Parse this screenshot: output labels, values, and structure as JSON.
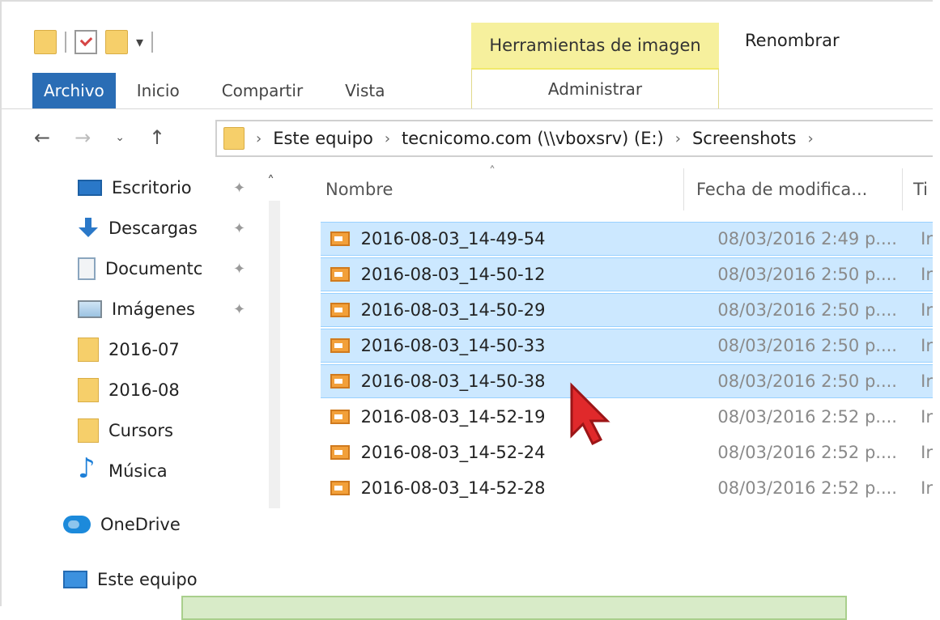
{
  "window": {
    "context_tab_group": "Herramientas de imagen",
    "context_tab": "Administrar",
    "rename_label": "Renombrar"
  },
  "ribbon": {
    "tabs": [
      {
        "label": "Archivo"
      },
      {
        "label": "Inicio"
      },
      {
        "label": "Compartir"
      },
      {
        "label": "Vista"
      }
    ]
  },
  "address": {
    "back": "←",
    "forward": "→",
    "recent": "⌄",
    "up": "↑",
    "crumbs": [
      "Este equipo",
      "tecnicomo.com (\\\\vboxsrv) (E:)",
      "Screenshots"
    ]
  },
  "navpane": {
    "quick_access": [
      {
        "label": "Escritorio",
        "icon": "desktop-icon",
        "pinned": true
      },
      {
        "label": "Descargas",
        "icon": "download-icon",
        "pinned": true
      },
      {
        "label": "Documentc",
        "icon": "document-icon",
        "pinned": true
      },
      {
        "label": "Imágenes",
        "icon": "pictures-icon",
        "pinned": true
      },
      {
        "label": "2016-07",
        "icon": "folder-icon",
        "pinned": false
      },
      {
        "label": "2016-08",
        "icon": "folder-icon",
        "pinned": false
      },
      {
        "label": "Cursors",
        "icon": "folder-icon",
        "pinned": false
      },
      {
        "label": "Música",
        "icon": "music-icon",
        "pinned": false
      }
    ],
    "onedrive": "OneDrive",
    "this_pc": "Este equipo"
  },
  "filelist": {
    "columns": {
      "name": "Nombre",
      "date": "Fecha de modifica...",
      "type": "Ti"
    },
    "rows": [
      {
        "name": "2016-08-03_14-49-54",
        "date": "08/03/2016 2:49 p....",
        "type": "Ir",
        "selected": true
      },
      {
        "name": "2016-08-03_14-50-12",
        "date": "08/03/2016 2:50 p....",
        "type": "Ir",
        "selected": true
      },
      {
        "name": "2016-08-03_14-50-29",
        "date": "08/03/2016 2:50 p....",
        "type": "Ir",
        "selected": true
      },
      {
        "name": "2016-08-03_14-50-33",
        "date": "08/03/2016 2:50 p....",
        "type": "Ir",
        "selected": true
      },
      {
        "name": "2016-08-03_14-50-38",
        "date": "08/03/2016 2:50 p....",
        "type": "Ir",
        "selected": true
      },
      {
        "name": "2016-08-03_14-52-19",
        "date": "08/03/2016 2:52 p....",
        "type": "Ir",
        "selected": false
      },
      {
        "name": "2016-08-03_14-52-24",
        "date": "08/03/2016 2:52 p....",
        "type": "Ir",
        "selected": false
      },
      {
        "name": "2016-08-03_14-52-28",
        "date": "08/03/2016 2:52 p....",
        "type": "Ir",
        "selected": false
      }
    ]
  },
  "colors": {
    "file_tab": "#2a6db5",
    "context_header": "#f6f09d",
    "selection": "#cce8ff",
    "cursor": "#e0292b",
    "caption_box": "#d8ebc8"
  }
}
